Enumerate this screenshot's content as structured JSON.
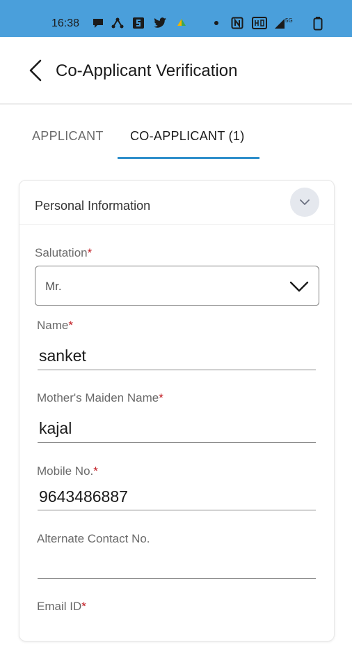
{
  "status_bar": {
    "time": "16:38",
    "icons": [
      "chat-bubble-icon",
      "network-icon",
      "s-app-icon",
      "twitter-icon",
      "drive-icon",
      "dot-icon",
      "nfc-icon",
      "volte-icon",
      "signal-5g-icon",
      "battery-icon"
    ],
    "signal_label": "5G",
    "background": "#4a9fdb"
  },
  "header": {
    "title": "Co-Applicant Verification"
  },
  "tabs": [
    {
      "label": "APPLICANT",
      "active": false
    },
    {
      "label": "CO-APPLICANT (1)",
      "active": true
    }
  ],
  "accent_color": "#2f8fcb",
  "required_color": "#c0181f",
  "section": {
    "title": "Personal Information",
    "expanded": true
  },
  "form": {
    "salutation": {
      "label": "Salutation",
      "required_mark": "*",
      "value": "Mr."
    },
    "name": {
      "label": "Name",
      "required_mark": "*",
      "value": "sanket"
    },
    "mother_maiden_name": {
      "label": "Mother's Maiden Name",
      "required_mark": "*",
      "value": "kajal"
    },
    "mobile": {
      "label": "Mobile No.",
      "required_mark": "*",
      "value": "9643486887"
    },
    "alternate_contact": {
      "label": "Alternate Contact No.",
      "value": ""
    },
    "email": {
      "label": "Email ID",
      "required_mark": "*",
      "value": ""
    }
  }
}
